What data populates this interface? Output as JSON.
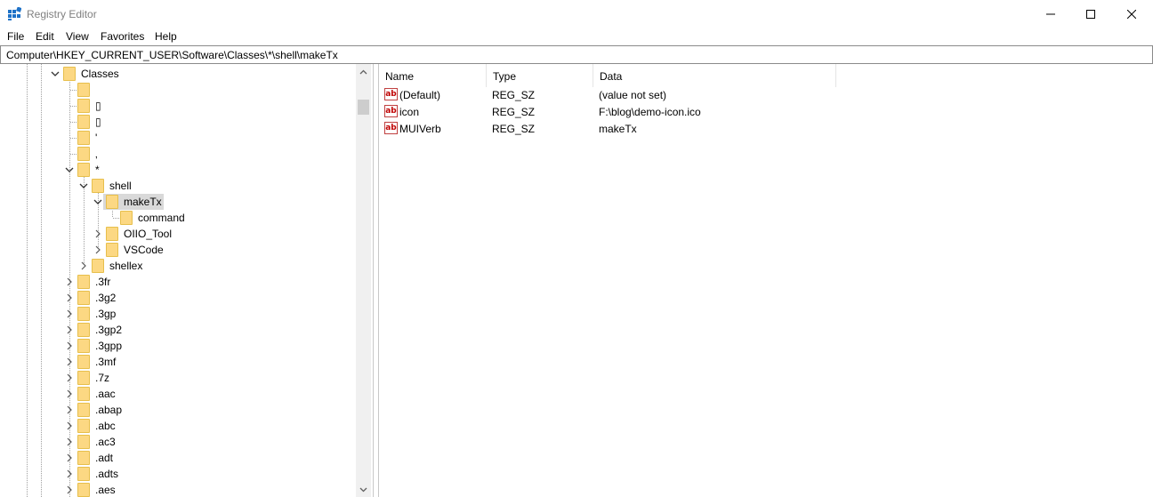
{
  "window": {
    "title": "Registry Editor"
  },
  "menu": [
    "File",
    "Edit",
    "View",
    "Favorites",
    "Help"
  ],
  "address": "Computer\\HKEY_CURRENT_USER\\Software\\Classes\\*\\shell\\makeTx",
  "tree": {
    "classes": "Classes",
    "unnamed": [
      "",
      "▯",
      "▯",
      "'",
      "‚"
    ],
    "star": "*",
    "shell": "shell",
    "makeTx": "makeTx",
    "command": "command",
    "oiio": "OIIO_Tool",
    "vscode": "VSCode",
    "shellex": "shellex",
    "extensions": [
      ".3fr",
      ".3g2",
      ".3gp",
      ".3gp2",
      ".3gpp",
      ".3mf",
      ".7z",
      ".aac",
      ".abap",
      ".abc",
      ".ac3",
      ".adt",
      ".adts",
      ".aes"
    ]
  },
  "list": {
    "columns": [
      "Name",
      "Type",
      "Data"
    ],
    "rows": [
      {
        "icon": "ab",
        "name": "(Default)",
        "type": "REG_SZ",
        "data": "(value not set)"
      },
      {
        "icon": "ab",
        "name": "icon",
        "type": "REG_SZ",
        "data": "F:\\blog\\demo-icon.ico"
      },
      {
        "icon": "ab",
        "name": "MUIVerb",
        "type": "REG_SZ",
        "data": "makeTx"
      }
    ]
  }
}
